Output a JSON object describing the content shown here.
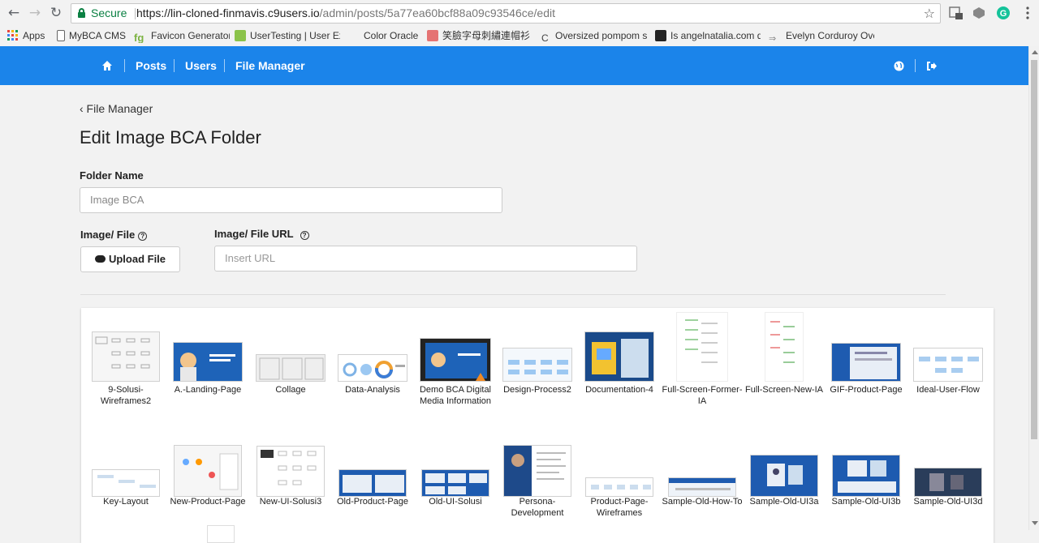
{
  "browser": {
    "secure_label": "Secure",
    "url_host": "https://lin-cloned-finmavis.c9users.io",
    "url_path": "/admin/posts/5a77ea60bcf88a09c93546ce/edit",
    "bookmarks": [
      {
        "label": "Apps",
        "color": "#e8453c"
      },
      {
        "label": "MyBCA CMS",
        "color": "#ffffff"
      },
      {
        "label": "Favicon Generator",
        "color": "#7cb342"
      },
      {
        "label": "UserTesting | User Exp",
        "color": "#8bc34a"
      },
      {
        "label": "Color Oracle",
        "color": "#ffffff"
      },
      {
        "label": "笑臉字母刺繡連帽衫",
        "color": "#e57373"
      },
      {
        "label": "Oversized pompom s",
        "color": "#ffffff"
      },
      {
        "label": "Is angelnatalia.com d",
        "color": "#222222"
      },
      {
        "label": "Evelyn Corduroy Ove",
        "color": "#888888"
      }
    ]
  },
  "navbar": {
    "home_icon": "home-icon",
    "items": [
      "Posts",
      "Users",
      "File Manager"
    ],
    "right_icons": [
      "globe-icon",
      "sign-out-icon"
    ]
  },
  "page": {
    "back_link": "‹ File Manager",
    "title": "Edit Image BCA Folder",
    "folder_name_label": "Folder Name",
    "folder_name_value": "Image BCA",
    "image_file_label": "Image/ File",
    "image_url_label": "Image/ File URL",
    "upload_button": "Upload File",
    "url_placeholder": "Insert URL"
  },
  "gallery": {
    "row1": [
      "9-Solusi-Wireframes2",
      "A.-Landing-Page",
      "Collage",
      "Data-Analysis",
      "Demo BCA Digital Media Information",
      "Design-Process2",
      "Documentation-4",
      "Full-Screen-Former-IA",
      "Full-Screen-New-IA",
      "GIF-Product-Page",
      "Ideal-User-Flow"
    ],
    "row2": [
      "Key-Layout",
      "New-Product-Page",
      "New-UI-Solusi3",
      "Old-Product-Page",
      "Old-UI-Solusi",
      "Persona-Development",
      "Product-Page-Wireframes",
      "Sample-Old-How-To",
      "Sample-Old-UI3a",
      "Sample-Old-UI3b",
      "Sample-Old-UI3d"
    ]
  },
  "colors": {
    "navbar": "#1b84ea",
    "secure": "#0b8043"
  }
}
